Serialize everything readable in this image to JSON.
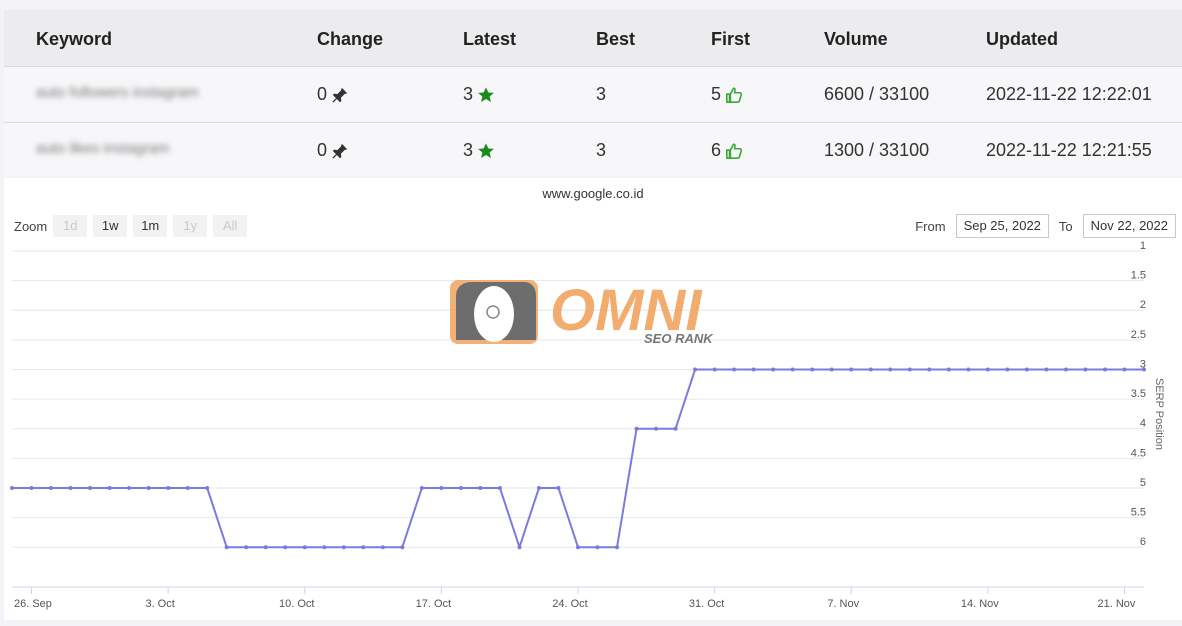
{
  "table": {
    "headers": {
      "keyword": "Keyword",
      "change": "Change",
      "latest": "Latest",
      "best": "Best",
      "first": "First",
      "volume": "Volume",
      "updated": "Updated"
    },
    "rows": [
      {
        "keyword": "auto followers instagram",
        "change": "0",
        "latest": "3",
        "best": "3",
        "first": "5",
        "volume": "6600 / 33100",
        "updated": "2022-11-22 12:22:01"
      },
      {
        "keyword": "auto likes instagram",
        "change": "0",
        "latest": "3",
        "best": "3",
        "first": "6",
        "volume": "1300 / 33100",
        "updated": "2022-11-22 12:21:55"
      }
    ],
    "icons": {
      "change": "pin-icon",
      "latest": "star-icon",
      "first": "thumbs-up-icon"
    },
    "colors": {
      "star": "#1a8a1a",
      "thumb": "#3aa93a"
    }
  },
  "chart_header": {
    "site": "www.google.co.id",
    "zoom_label": "Zoom",
    "zoom_buttons": [
      {
        "label": "1d",
        "enabled": false
      },
      {
        "label": "1w",
        "enabled": true
      },
      {
        "label": "1m",
        "enabled": true
      },
      {
        "label": "1y",
        "enabled": false
      },
      {
        "label": "All",
        "enabled": false
      }
    ],
    "from_label": "From",
    "from_value": "Sep 25, 2022",
    "to_label": "To",
    "to_value": "Nov 22, 2022"
  },
  "watermark": {
    "brand": "OMNI",
    "sub": "SEO RANK"
  },
  "chart_data": {
    "type": "line",
    "title": "www.google.co.id",
    "ylabel": "SERP Position",
    "y_reversed": true,
    "ylim": [
      1,
      6
    ],
    "yticks": [
      "1",
      "1.5",
      "2",
      "2.5",
      "3",
      "3.5",
      "4",
      "4.5",
      "5",
      "5.5",
      "6"
    ],
    "xticks": [
      "26. Sep",
      "3. Oct",
      "10. Oct",
      "17. Oct",
      "24. Oct",
      "31. Oct",
      "7. Nov",
      "14. Nov",
      "21. Nov"
    ],
    "x": [
      "2022-09-25",
      "2022-09-26",
      "2022-09-27",
      "2022-09-28",
      "2022-09-29",
      "2022-09-30",
      "2022-10-01",
      "2022-10-02",
      "2022-10-03",
      "2022-10-04",
      "2022-10-05",
      "2022-10-06",
      "2022-10-07",
      "2022-10-08",
      "2022-10-09",
      "2022-10-10",
      "2022-10-11",
      "2022-10-12",
      "2022-10-13",
      "2022-10-14",
      "2022-10-15",
      "2022-10-16",
      "2022-10-17",
      "2022-10-18",
      "2022-10-19",
      "2022-10-20",
      "2022-10-21",
      "2022-10-22",
      "2022-10-23",
      "2022-10-24",
      "2022-10-25",
      "2022-10-26",
      "2022-10-27",
      "2022-10-28",
      "2022-10-29",
      "2022-10-30",
      "2022-10-31",
      "2022-11-01",
      "2022-11-02",
      "2022-11-03",
      "2022-11-04",
      "2022-11-05",
      "2022-11-06",
      "2022-11-07",
      "2022-11-08",
      "2022-11-09",
      "2022-11-10",
      "2022-11-11",
      "2022-11-12",
      "2022-11-13",
      "2022-11-14",
      "2022-11-15",
      "2022-11-16",
      "2022-11-17",
      "2022-11-18",
      "2022-11-19",
      "2022-11-20",
      "2022-11-21",
      "2022-11-22"
    ],
    "series": [
      {
        "values": [
          5,
          5,
          5,
          5,
          5,
          5,
          5,
          5,
          5,
          5,
          5,
          6,
          6,
          6,
          6,
          6,
          6,
          6,
          6,
          6,
          6,
          5,
          5,
          5,
          5,
          5,
          6,
          5,
          5,
          6,
          6,
          6,
          4,
          4,
          4,
          3,
          3,
          3,
          3,
          3,
          3,
          3,
          3,
          3,
          3,
          3,
          3,
          3,
          3,
          3,
          3,
          3,
          3,
          3,
          3,
          3,
          3,
          3,
          3
        ]
      }
    ],
    "colors": {
      "line": "#7b7bdf"
    },
    "grid": true
  }
}
